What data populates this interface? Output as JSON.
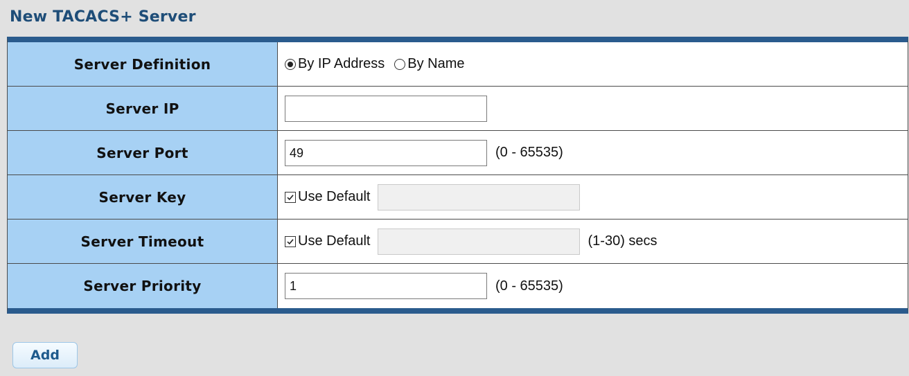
{
  "panel": {
    "title": "New TACACS+ Server"
  },
  "form": {
    "server_definition": {
      "label": "Server Definition",
      "options": [
        "By IP Address",
        "By Name"
      ],
      "selected": "By IP Address"
    },
    "server_ip": {
      "label": "Server IP",
      "value": ""
    },
    "server_port": {
      "label": "Server Port",
      "value": "49",
      "range": "(0 - 65535)"
    },
    "server_key": {
      "label": "Server Key",
      "use_default_label": "Use Default",
      "use_default_checked": true,
      "value": ""
    },
    "server_timeout": {
      "label": "Server Timeout",
      "use_default_label": "Use Default",
      "use_default_checked": true,
      "value": "",
      "range": "(1-30) secs"
    },
    "server_priority": {
      "label": "Server Priority",
      "value": "1",
      "range": "(0 - 65535)"
    }
  },
  "actions": {
    "add_label": "Add"
  },
  "colors": {
    "header_bar": "#2a5b8d",
    "label_bg": "#a7d1f4",
    "title_text": "#1e4d78",
    "page_bg": "#e1e1e1"
  }
}
